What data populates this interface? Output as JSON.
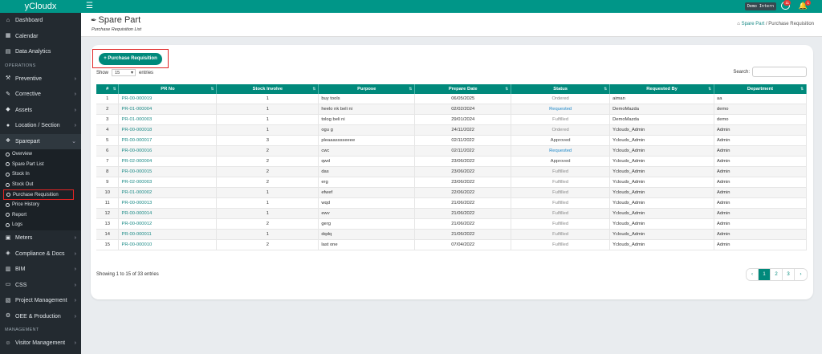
{
  "app": {
    "brand": "yCloudx"
  },
  "topbar": {
    "demo_badge": "Demo Intern",
    "chat_count": "11",
    "bell_count": "1"
  },
  "sidebar": {
    "top_items": [
      {
        "label": "Dashboard",
        "icon": "home-icon"
      },
      {
        "label": "Calendar",
        "icon": "calendar-icon"
      },
      {
        "label": "Data Analytics",
        "icon": "chart-icon"
      }
    ],
    "operations_section": "OPERATIONS",
    "op_items": [
      {
        "label": "Preventive",
        "icon": "wrench-icon"
      },
      {
        "label": "Corrective",
        "icon": "pencil-icon"
      },
      {
        "label": "Assets",
        "icon": "tag-icon"
      },
      {
        "label": "Location / Section",
        "icon": "location-icon"
      },
      {
        "label": "Sparepart",
        "icon": "cart-icon"
      }
    ],
    "sparepart_sub": [
      "Overview",
      "Spare Part List",
      "Stock In",
      "Stock Out",
      "Purchase Requisition",
      "Price History",
      "Report",
      "Logs"
    ],
    "more_items": [
      {
        "label": "Meters",
        "icon": "meter-icon"
      },
      {
        "label": "Compliance & Docs",
        "icon": "shield-icon"
      },
      {
        "label": "BIM",
        "icon": "building-icon"
      },
      {
        "label": "CSS",
        "icon": "chat-icon"
      },
      {
        "label": "Project Management",
        "icon": "folder-icon"
      },
      {
        "label": "OEE & Production",
        "icon": "gear-icon"
      }
    ],
    "management_section": "MANAGEMENT",
    "mgmt_items": [
      {
        "label": "Visitor Management",
        "icon": "user-icon"
      }
    ]
  },
  "header": {
    "title": "Spare Part",
    "subtitle": "Purchase Requisition List",
    "breadcrumb": {
      "link": "Spare Part",
      "sep": "/",
      "current": "Purchase Requisition"
    }
  },
  "controls": {
    "add_button": "Purchase Requisition",
    "show_label": "Show",
    "show_value": "15",
    "entries_label": "entries",
    "search_label": "Search:"
  },
  "table": {
    "columns": [
      "#",
      "PR No",
      "Stock Involve",
      "Purpose",
      "Prepare Date",
      "Status",
      "Requested By",
      "Department"
    ],
    "rows": [
      [
        "1",
        "PR-00-000019",
        "1",
        "buy tools",
        "06/05/2025",
        "Ordered",
        "aiman",
        "aa"
      ],
      [
        "2",
        "PR-01-000004",
        "1",
        "heelo nk beli ni",
        "02/02/2024",
        "Requested",
        "DemoMazda",
        "demo"
      ],
      [
        "3",
        "PR-01-000003",
        "1",
        "tolog beli ni",
        "29/01/2024",
        "Fulfilled",
        "DemoMazda",
        "demo"
      ],
      [
        "4",
        "PR-00-000018",
        "1",
        "ogu g",
        "24/11/2022",
        "Ordered",
        "Ycloudx_Admin",
        "Admin"
      ],
      [
        "5",
        "PR-00-000017",
        "3",
        "pleaaasssseeee",
        "02/11/2022",
        "Approved",
        "Ycloudx_Admin",
        "Admin"
      ],
      [
        "6",
        "PR-00-000016",
        "2",
        "cwc",
        "02/11/2022",
        "Requested",
        "Ycloudx_Admin",
        "Admin"
      ],
      [
        "7",
        "PR-02-000004",
        "2",
        "qwd",
        "23/06/2022",
        "Approved",
        "Ycloudx_Admin",
        "Admin"
      ],
      [
        "8",
        "PR-00-000015",
        "2",
        "das",
        "23/06/2022",
        "Fulfilled",
        "Ycloudx_Admin",
        "Admin"
      ],
      [
        "9",
        "PR-02-000003",
        "2",
        "erg",
        "23/06/2022",
        "Fulfilled",
        "Ycloudx_Admin",
        "Admin"
      ],
      [
        "10",
        "PR-01-000002",
        "1",
        "efwef",
        "22/06/2022",
        "Fulfilled",
        "Ycloudx_Admin",
        "Admin"
      ],
      [
        "11",
        "PR-00-000013",
        "1",
        "wqd",
        "21/06/2022",
        "Fulfilled",
        "Ycloudx_Admin",
        "Admin"
      ],
      [
        "12",
        "PR-00-000014",
        "1",
        "ewv",
        "21/06/2022",
        "Fulfilled",
        "Ycloudx_Admin",
        "Admin"
      ],
      [
        "13",
        "PR-00-000012",
        "2",
        "gerg",
        "21/06/2022",
        "Fulfilled",
        "Ycloudx_Admin",
        "Admin"
      ],
      [
        "14",
        "PR-00-000011",
        "1",
        "dqdq",
        "21/06/2022",
        "Fulfilled",
        "Ycloudx_Admin",
        "Admin"
      ],
      [
        "15",
        "PR-00-000010",
        "2",
        "last one",
        "07/04/2022",
        "Fulfilled",
        "Ycloudx_Admin",
        "Admin"
      ]
    ]
  },
  "footer": {
    "info": "Showing 1 to 15 of 33 entries",
    "pages": [
      "‹",
      "1",
      "2",
      "3",
      "›"
    ]
  },
  "colors": {
    "accent": "#009688",
    "sidebar": "#232a30",
    "link": "#1a8a86",
    "requested": "#1e88c9",
    "highlight_box": "#e02424"
  }
}
